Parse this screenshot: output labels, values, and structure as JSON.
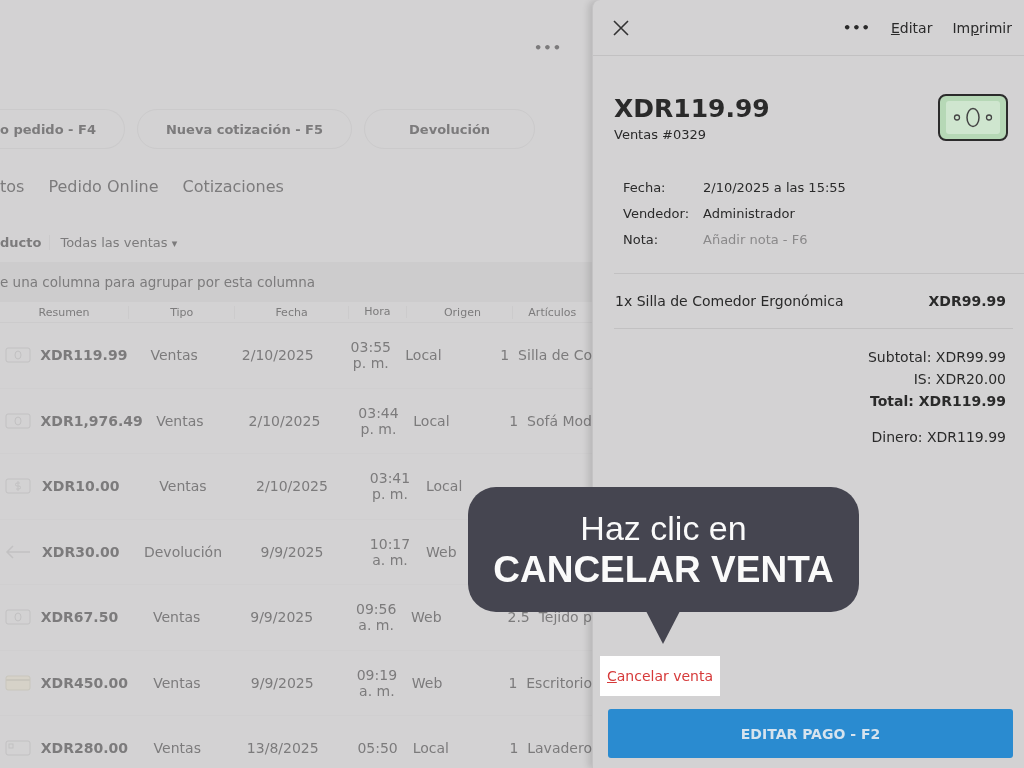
{
  "background": {
    "toolbar_more": "•••",
    "action_buttons": [
      "o pedido - F4",
      "Nueva cotización - F5",
      "Devolución"
    ],
    "tabs": [
      "tos",
      "Pedido Online",
      "Cotizaciones"
    ],
    "filters": {
      "group_label": "ducto",
      "sales_filter": "Todas las ventas",
      "caret": "▾"
    },
    "group_hint": "e una columna para agrupar por esta columna",
    "table": {
      "columns": [
        "Resumen",
        "Tipo",
        "Fecha",
        "Hora",
        "Origen",
        "Artículos"
      ],
      "rows": [
        {
          "kind": "cash",
          "summary": "XDR119.99",
          "type": "Ventas",
          "date": "2/10/2025",
          "time": [
            "03:55",
            "p. m."
          ],
          "origin": "Local",
          "items": [
            {
              "qty": "1",
              "name": "Silla de Co"
            }
          ]
        },
        {
          "kind": "cash",
          "summary": "XDR1,976.49",
          "type": "Ventas",
          "date": "2/10/2025",
          "time": [
            "03:44",
            "p. m."
          ],
          "origin": "Local",
          "items": [
            {
              "qty": "1",
              "name": "Sofá Mod"
            }
          ]
        },
        {
          "kind": "dollar",
          "summary": "XDR10.00",
          "type": "Ventas",
          "date": "2/10/2025",
          "time": [
            "03:41",
            "p. m."
          ],
          "origin": "Local"
        },
        {
          "kind": "return",
          "summary": "XDR30.00",
          "type": "Devolución",
          "date": "9/9/2025",
          "time": [
            "10:17",
            "a. m."
          ],
          "origin": "Web"
        },
        {
          "kind": "cash",
          "summary": "XDR67.50",
          "type": "Ventas",
          "date": "9/9/2025",
          "time": [
            "09:56",
            "a. m."
          ],
          "origin": "Web",
          "items": [
            {
              "qty": "2.5",
              "name": "Tejido p"
            }
          ]
        },
        {
          "kind": "card",
          "summary": "XDR450.00",
          "type": "Ventas",
          "date": "9/9/2025",
          "time": [
            "09:19",
            "a. m."
          ],
          "origin": "Web",
          "items": [
            {
              "qty": "1",
              "name": "Escritorio"
            }
          ]
        },
        {
          "kind": "other",
          "summary": "XDR280.00",
          "type": "Ventas",
          "date": "13/8/2025",
          "time": [
            "05:50"
          ],
          "origin": "Local",
          "items": [
            {
              "qty": "1",
              "name": "Lavadero"
            }
          ]
        }
      ]
    }
  },
  "panel": {
    "header_more": "•••",
    "header_links": [
      "Editar",
      "Imprimir"
    ],
    "amount": "XDR119.99",
    "reference": "Ventas #0329",
    "details": [
      {
        "label": "Fecha:",
        "value": "2/10/2025 a las 15:55",
        "kind": "value"
      },
      {
        "label": "Vendedor:",
        "value": "Administrador",
        "kind": "value"
      },
      {
        "label": "Nota:",
        "placeholder": "Añadir nota - F6",
        "kind": "placeholder"
      }
    ],
    "line_items": [
      {
        "description": "1x Silla de Comedor Ergonómica",
        "price": "XDR99.99"
      }
    ],
    "totals": [
      {
        "text": "Subtotal: XDR99.99",
        "kind": "normal"
      },
      {
        "text": "IS: XDR20.00",
        "kind": "normal"
      },
      {
        "text": "Total: XDR119.99",
        "kind": "total"
      },
      {
        "text": "Dinero: XDR119.99",
        "kind": "payment"
      }
    ],
    "cancel_link": {
      "label": "Cancelar venta",
      "highlighted": true
    },
    "primary_button": "EDITAR PAGO - F2"
  },
  "callout": {
    "line_1": "Haz clic en",
    "line_2": "CANCELAR VENTA"
  }
}
